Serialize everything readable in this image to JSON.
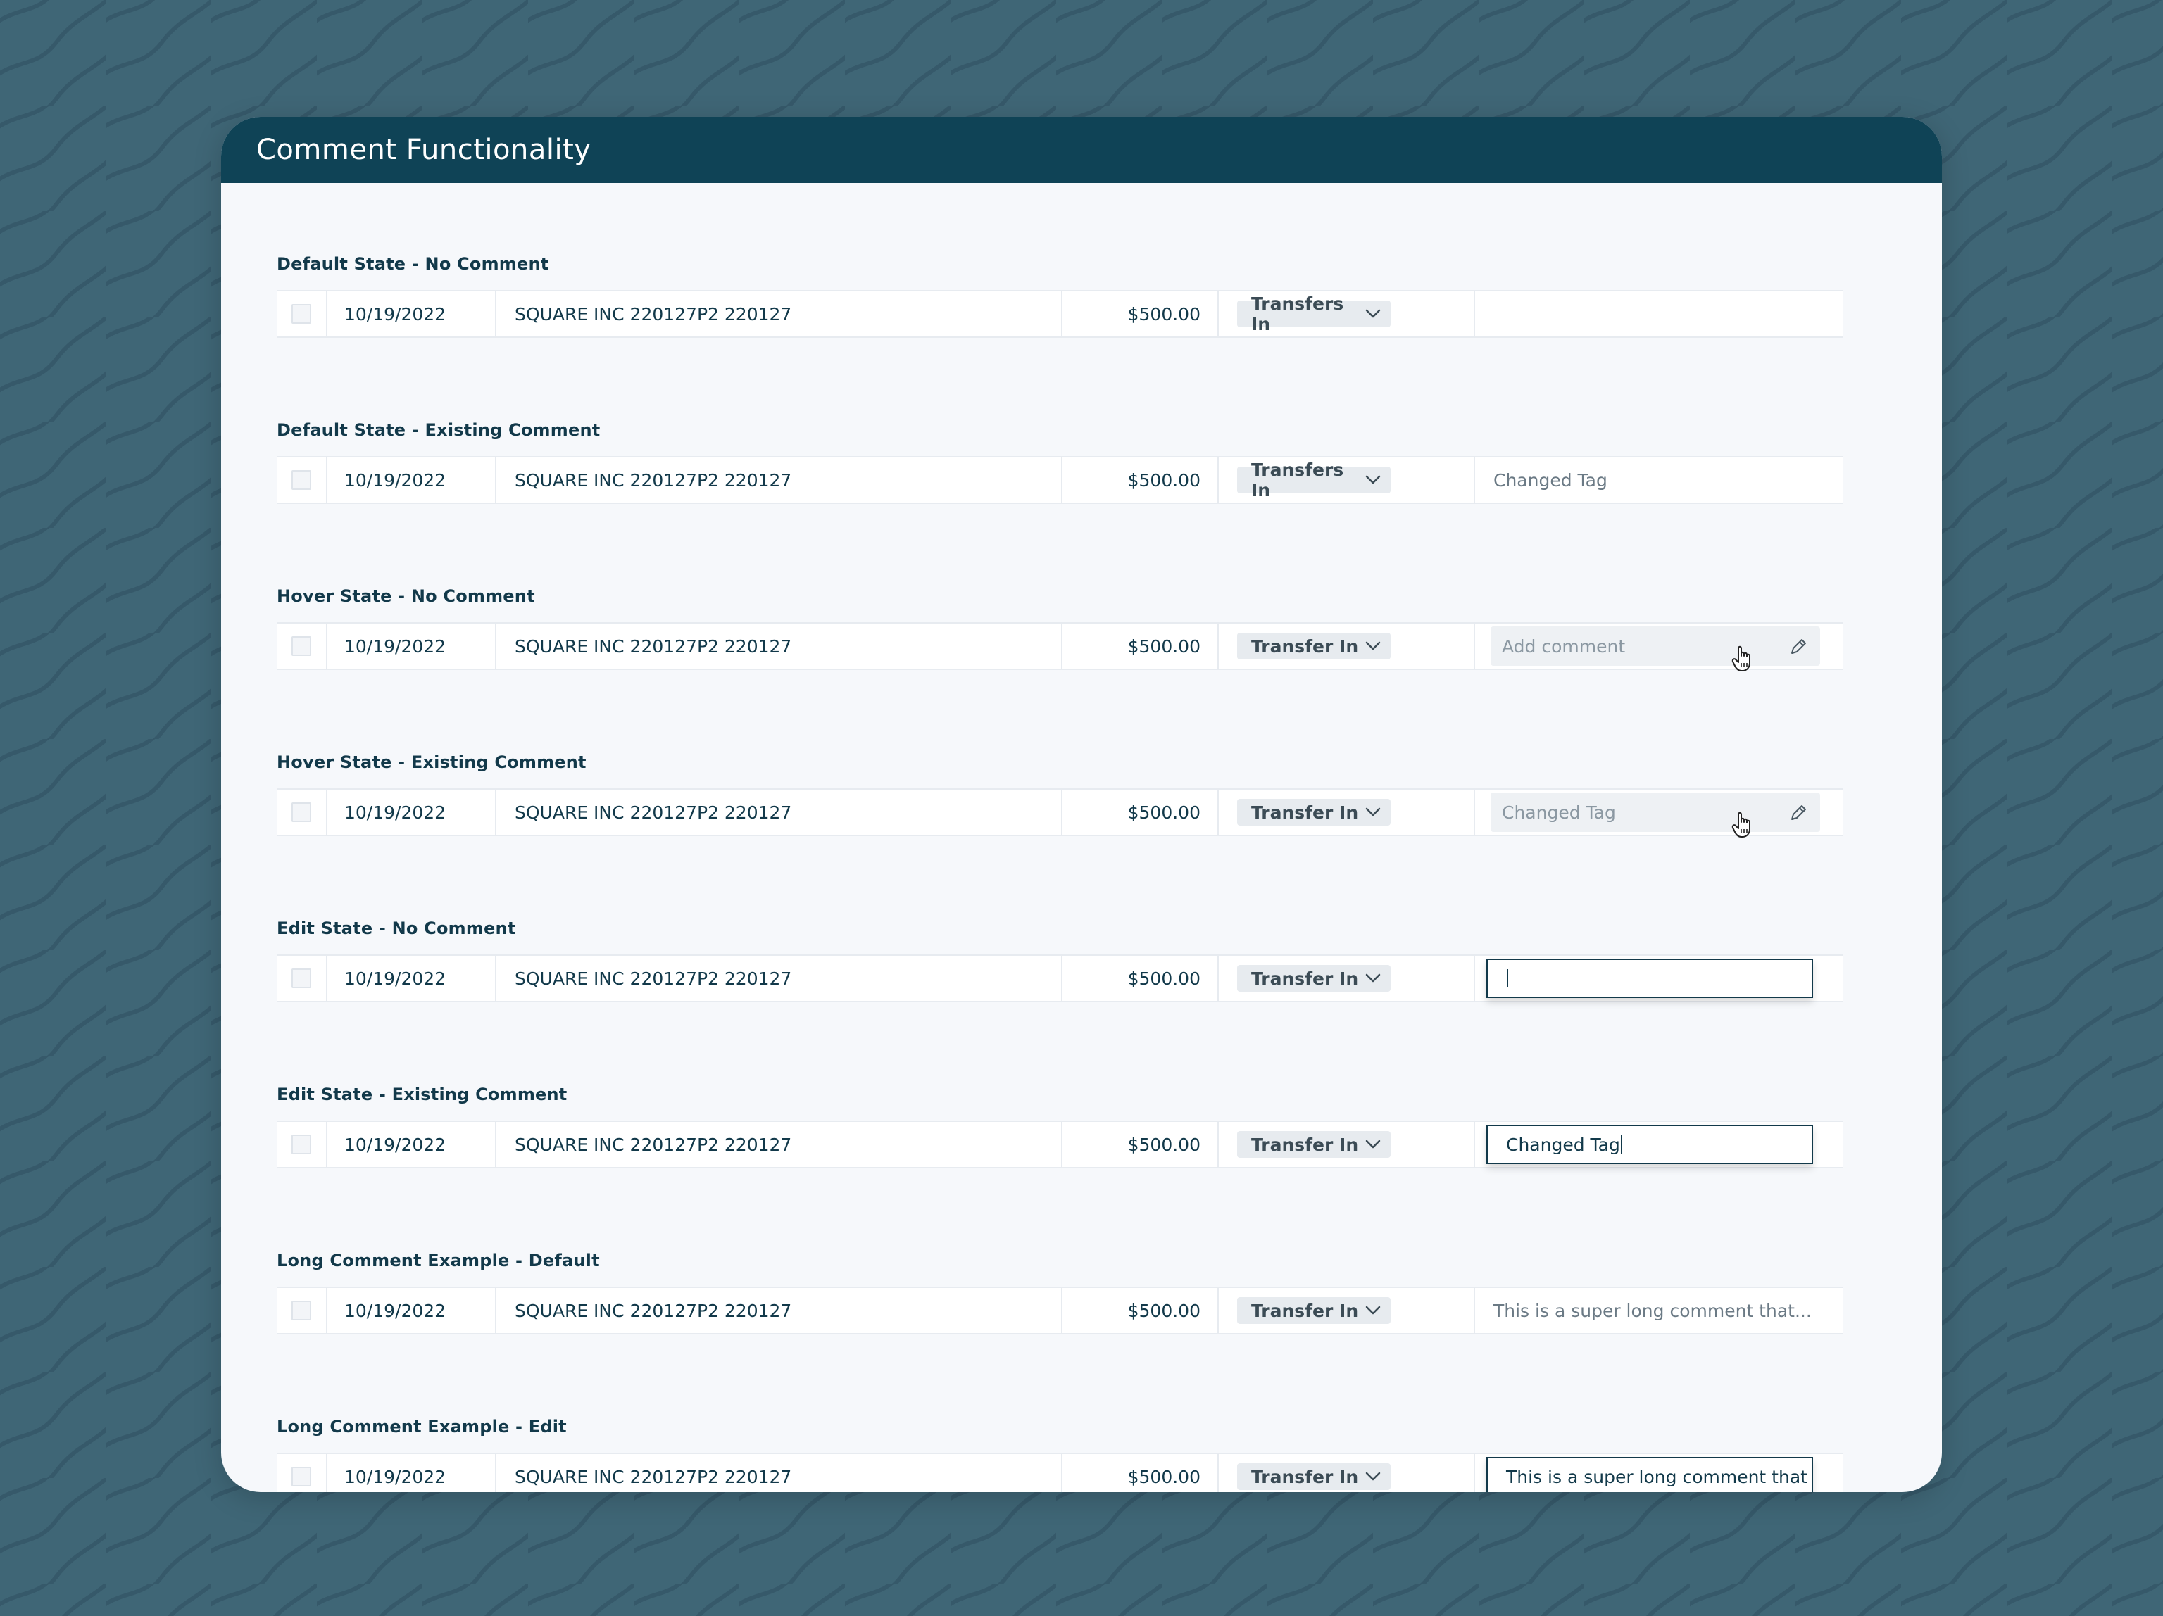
{
  "page": {
    "title": "Comment Functionality"
  },
  "colors": {
    "background": "#3f6676",
    "header": "#0f4356",
    "text": "#12394a",
    "card": "#f6f8fb"
  },
  "sections": [
    {
      "title": "Default State - No Comment",
      "state": "default",
      "row": {
        "date": "10/19/2022",
        "description": "SQUARE INC 220127P2 220127",
        "amount": "$500.00",
        "tag": "Transfers In",
        "comment": ""
      }
    },
    {
      "title": "Default State - Existing Comment",
      "state": "default",
      "row": {
        "date": "10/19/2022",
        "description": "SQUARE INC 220127P2 220127",
        "amount": "$500.00",
        "tag": "Transfers In",
        "comment": "Changed Tag"
      }
    },
    {
      "title": "Hover State - No Comment",
      "state": "hover",
      "row": {
        "date": "10/19/2022",
        "description": "SQUARE INC 220127P2 220127",
        "amount": "$500.00",
        "tag": "Transfer In",
        "comment": "Add comment"
      }
    },
    {
      "title": "Hover State - Existing Comment",
      "state": "hover",
      "row": {
        "date": "10/19/2022",
        "description": "SQUARE INC 220127P2 220127",
        "amount": "$500.00",
        "tag": "Transfer In",
        "comment": "Changed Tag"
      }
    },
    {
      "title": "Edit State - No Comment",
      "state": "edit",
      "row": {
        "date": "10/19/2022",
        "description": "SQUARE INC 220127P2 220127",
        "amount": "$500.00",
        "tag": "Transfer In",
        "comment": ""
      }
    },
    {
      "title": "Edit State - Existing Comment",
      "state": "edit",
      "row": {
        "date": "10/19/2022",
        "description": "SQUARE INC 220127P2 220127",
        "amount": "$500.00",
        "tag": "Transfer In",
        "comment": "Changed Tag"
      }
    },
    {
      "title": "Long Comment Example - Default",
      "state": "default",
      "row": {
        "date": "10/19/2022",
        "description": "SQUARE INC 220127P2 220127",
        "amount": "$500.00",
        "tag": "Transfer In",
        "comment": "This is a super long comment that..."
      }
    },
    {
      "title": "Long Comment Example - Edit",
      "state": "edit-partial",
      "row": {
        "date": "10/19/2022",
        "description": "SQUARE INC 220127P2 220127",
        "amount": "$500.00",
        "tag": "Transfer In",
        "comment": "This is a super long comment that"
      }
    }
  ],
  "icons": {
    "tag_dropdown": "chevron-down-icon",
    "edit": "pencil-icon",
    "cursor": "hand-pointer-icon"
  }
}
